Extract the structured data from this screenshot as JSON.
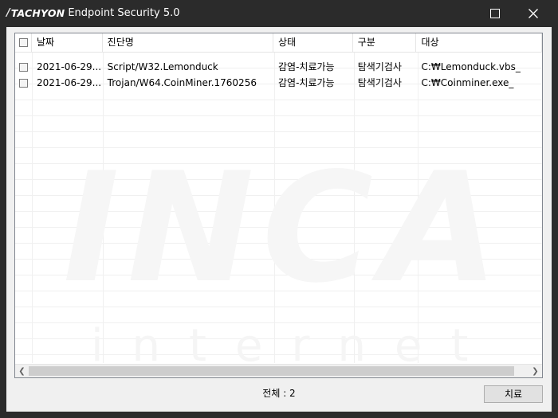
{
  "window": {
    "brand_slash": "/",
    "brand_logo": "TACHYON",
    "title": "Endpoint Security 5.0"
  },
  "watermark": {
    "big": "INCA",
    "small": "internet"
  },
  "table": {
    "columns": [
      "날짜",
      "진단명",
      "상태",
      "구분",
      "대상"
    ],
    "rows": [
      {
        "checked": false,
        "date": "2021-06-29...",
        "name": "Script/W32.Lemonduck",
        "status": "감염-치료가능",
        "type": "탐색기검사",
        "target": "C:₩Lemonduck.vbs_"
      },
      {
        "checked": false,
        "date": "2021-06-29...",
        "name": "Trojan/W64.CoinMiner.1760256",
        "status": "감염-치료가능",
        "type": "탐색기검사",
        "target": "C:₩Coinminer.exe_"
      }
    ]
  },
  "footer": {
    "total_text": "전체 : 2",
    "treat_button": "치료"
  }
}
